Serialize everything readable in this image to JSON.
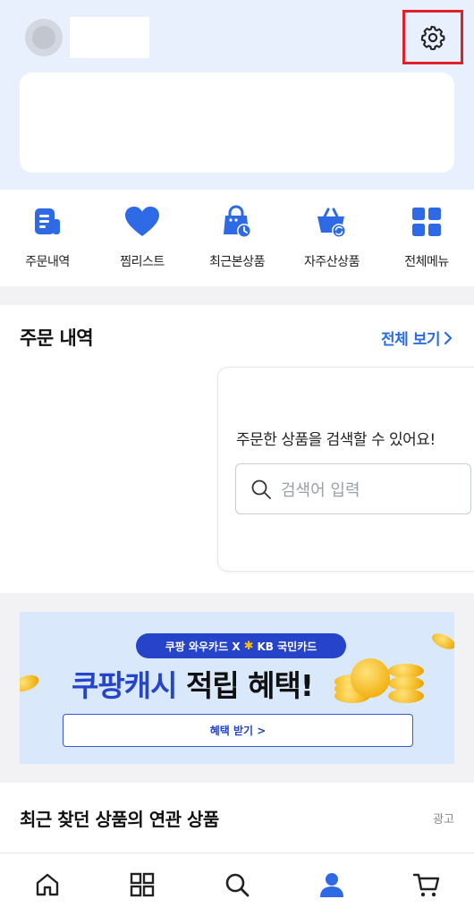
{
  "shortcuts": [
    {
      "label": "주문내역",
      "icon": "order-history-icon"
    },
    {
      "label": "찜리스트",
      "icon": "heart-icon"
    },
    {
      "label": "최근본상품",
      "icon": "recent-bag-icon"
    },
    {
      "label": "자주산상품",
      "icon": "frequent-basket-icon"
    },
    {
      "label": "전체메뉴",
      "icon": "grid-menu-icon"
    }
  ],
  "orders": {
    "title": "주문 내역",
    "view_all": "전체 보기",
    "search_caption": "주문한 상품을 검색할 수 있어요!",
    "search_placeholder": "검색어 입력"
  },
  "banner": {
    "pill_left": "쿠팡 와우카드 X",
    "pill_right": "KB 국민카드",
    "headline_blue": "쿠팡캐시",
    "headline_dark": "적립 혜택!",
    "button": "혜택 받기 >"
  },
  "related": {
    "title": "최근 찾던 상품의 연관 상품",
    "ad_label": "광고"
  },
  "tabbar": [
    {
      "icon": "home-icon"
    },
    {
      "icon": "category-icon"
    },
    {
      "icon": "search-icon"
    },
    {
      "icon": "my-coupang-icon",
      "active": true
    },
    {
      "icon": "cart-icon"
    }
  ],
  "colors": {
    "accent": "#2a6de0",
    "icon_blue": "#2f6ae6",
    "header_bg": "#e9f0fd",
    "highlight_border": "#e0202a"
  }
}
